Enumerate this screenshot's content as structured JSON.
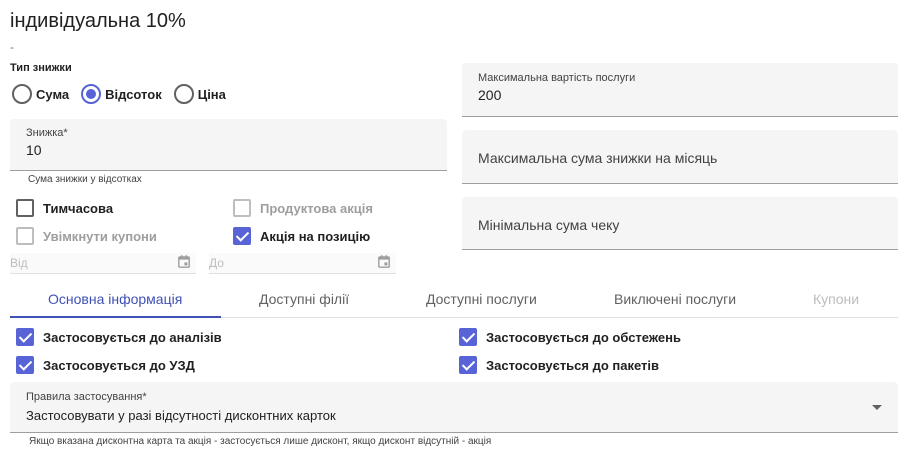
{
  "header": {
    "title": "індивідуальна 10%",
    "subtitle": "-"
  },
  "discount_type": {
    "label": "Тип знижки",
    "options": [
      {
        "label": "Сума",
        "selected": false
      },
      {
        "label": "Відсоток",
        "selected": true
      },
      {
        "label": "Ціна",
        "selected": false
      }
    ]
  },
  "discount_field": {
    "label": "Знижка*",
    "value": "10",
    "helper": "Сума знижки у відсотках"
  },
  "right_fields": {
    "max_service_cost": {
      "label": "Максимальна вартість послуги",
      "value": "200"
    },
    "max_monthly_discount": {
      "placeholder": "Максимальна сума знижки на місяць"
    },
    "min_check": {
      "placeholder": "Мінімальна сума чеку"
    }
  },
  "options": {
    "temporary": {
      "label": "Тимчасова",
      "checked": false,
      "disabled": false
    },
    "product_promo": {
      "label": "Продуктова акція",
      "checked": false,
      "disabled": true
    },
    "enable_coupons": {
      "label": "Увімкнути купони",
      "checked": false,
      "disabled": true
    },
    "position_promo": {
      "label": "Акція на позицію",
      "checked": true,
      "disabled": false
    }
  },
  "dates": {
    "from_placeholder": "Від",
    "to_placeholder": "До"
  },
  "tabs": [
    {
      "label": "Основна інформація",
      "state": "active"
    },
    {
      "label": "Доступні філії",
      "state": "normal"
    },
    {
      "label": "Доступні послуги",
      "state": "normal"
    },
    {
      "label": "Виключені послуги",
      "state": "normal"
    },
    {
      "label": "Купони",
      "state": "disabled"
    }
  ],
  "applies": {
    "analyses": {
      "label": "Застосовується до аналізів",
      "checked": true
    },
    "examinations": {
      "label": "Застосовується до обстежень",
      "checked": true
    },
    "ultrasound": {
      "label": "Застосовується до УЗД",
      "checked": true
    },
    "packages": {
      "label": "Застосовується до пакетів",
      "checked": true
    }
  },
  "rules": {
    "label": "Правила застосування*",
    "value": "Застосовувати у разі відсутності дисконтних карток",
    "helper": "Якщо вказана дисконтна карта та акція - застосується лише дисконт, якщо дисконт відсутній - акція"
  },
  "colors": {
    "accent": "#5863d6",
    "tab_active": "#3f51b5",
    "field_bg": "#f5f5f5"
  }
}
